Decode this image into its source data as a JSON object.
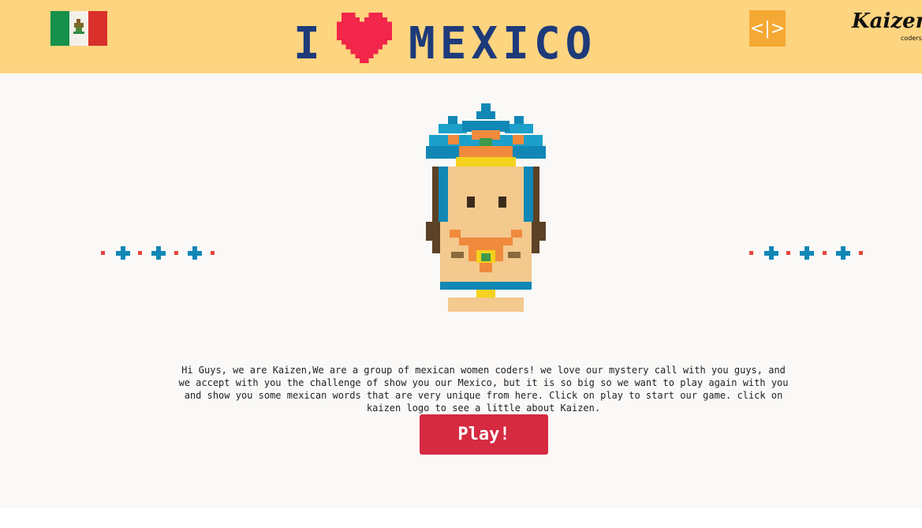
{
  "header": {
    "title_prefix": "I",
    "title_word": "MEXICO",
    "code_button_label": "<|>",
    "logo_text": "Kaizen",
    "logo_subtext": "coders",
    "flag_icon": "mexico-flag-icon",
    "heart_icon": "heart-icon"
  },
  "main": {
    "intro_text": "Hi Guys, we are Kaizen,We are a group of mexican women coders! we love our mystery call with you guys, and we accept with you the challenge of show you our Mexico, but it is so big so we want to play again with you and show you some mexican words that are very unique from here. Click on play to start our game. click on kaizen logo to see a little about Kaizen.",
    "play_button_label": "Play!",
    "character_icon": "aztec-character-icon"
  },
  "colors": {
    "header_bg": "#fdd47f",
    "accent_orange": "#f5a934",
    "play_red": "#d62a41",
    "title_blue": "#1d3a7a",
    "heart_red": "#f2254a",
    "deco_blue": "#1187b5",
    "deco_red": "#e8453c"
  }
}
